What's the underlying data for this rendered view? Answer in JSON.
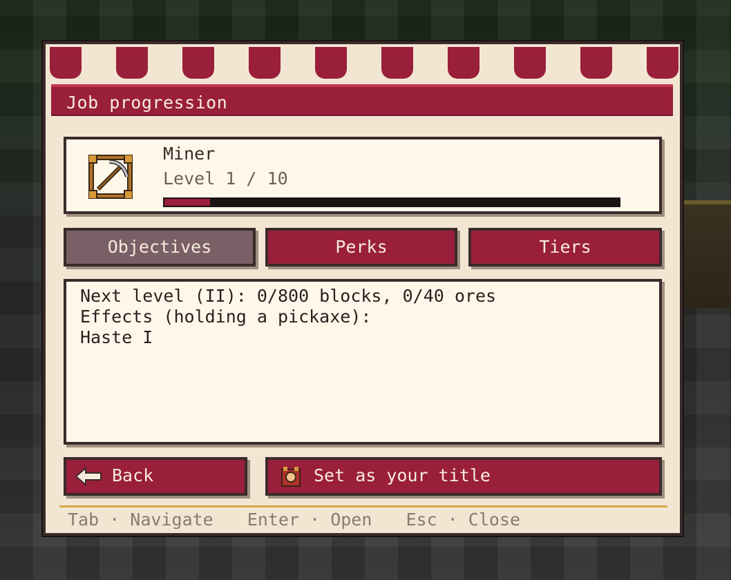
{
  "panel": {
    "title": "Job progression",
    "colors": {
      "accent": "#9a1f3a",
      "panel_bg": "#f2e6d2",
      "card_bg": "#fff8ea",
      "tab_active": "#7a6066"
    }
  },
  "job": {
    "icon": "pickaxe-frame-icon",
    "name": "Miner",
    "level_text": "Level 1 / 10",
    "progress_fraction": 0.1
  },
  "tabs": [
    {
      "label": "Objectives",
      "active": true
    },
    {
      "label": "Perks",
      "active": false
    },
    {
      "label": "Tiers",
      "active": false
    }
  ],
  "content": {
    "lines": [
      "Next level (II): 0/800 blocks, 0/40 ores",
      "Effects (holding a pickaxe):",
      "Haste I"
    ]
  },
  "buttons": {
    "back": {
      "label": "Back",
      "icon": "arrow-left-icon"
    },
    "title": {
      "label": "Set as your title",
      "icon": "title-badge-icon"
    }
  },
  "footer": {
    "hints": [
      "Tab · Navigate",
      "Enter · Open",
      "Esc · Close"
    ]
  }
}
